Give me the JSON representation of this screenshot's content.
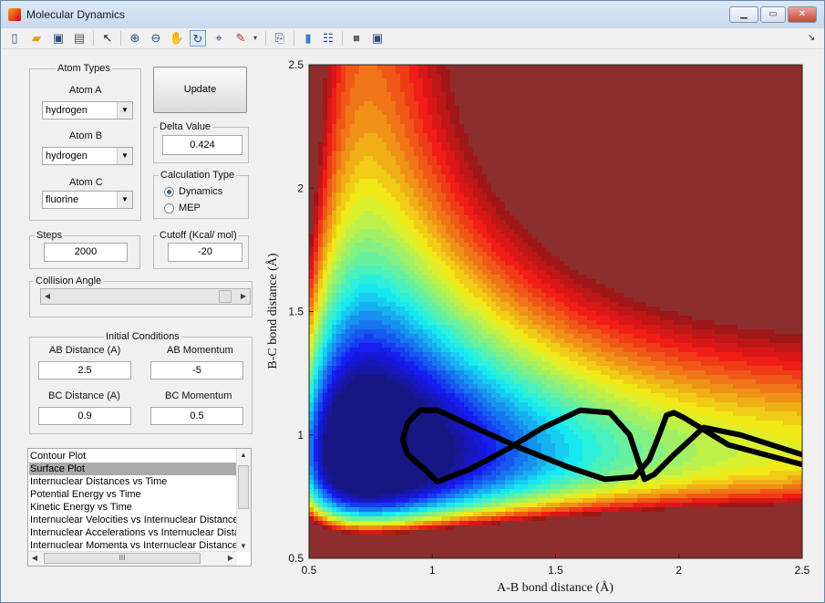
{
  "window": {
    "title": "Molecular Dynamics"
  },
  "toolbar": {
    "icons": [
      "new-file-icon",
      "open-folder-icon",
      "save-icon",
      "print-icon",
      "pointer-icon",
      "zoom-in-icon",
      "zoom-out-icon",
      "pan-hand-icon",
      "rotate-3d-icon",
      "data-cursor-icon",
      "brush-icon",
      "dropdown-arrow-icon",
      "link-plot-icon",
      "colorbar-icon",
      "legend-icon",
      "hide-plot-tools-icon",
      "show-plot-tools-icon",
      "dock-icon"
    ]
  },
  "controls": {
    "atom_types_title": "Atom Types",
    "atom_a_label": "Atom A",
    "atom_a_value": "hydrogen",
    "atom_b_label": "Atom B",
    "atom_b_value": "hydrogen",
    "atom_c_label": "Atom C",
    "atom_c_value": "fluorine",
    "update_label": "Update",
    "delta_title": "Delta Value",
    "delta_value": "0.424",
    "calc_type_title": "Calculation Type",
    "calc_options": [
      "Dynamics",
      "MEP"
    ],
    "calc_selected": "Dynamics",
    "steps_title": "Steps",
    "steps_value": "2000",
    "cutoff_title": "Cutoff (Kcal/ mol)",
    "cutoff_value": "-20",
    "collision_title": "Collision Angle",
    "collision_angle_fraction": 0.97,
    "initial_title": "Initial Conditions",
    "ab_distance_label": "AB Distance (A)",
    "ab_distance_value": "2.5",
    "ab_momentum_label": "AB Momentum",
    "ab_momentum_value": "-5",
    "bc_distance_label": "BC Distance (A)",
    "bc_distance_value": "0.9",
    "bc_momentum_label": "BC Momentum",
    "bc_momentum_value": "0.5"
  },
  "plot_list": {
    "items": [
      "Contour Plot",
      "Surface Plot",
      "Internuclear Distances vs Time",
      "Potential Energy vs Time",
      "Kinetic Energy vs Time",
      "Internuclear Velocities vs Internuclear Distance",
      "Internuclear Accelerations vs Internuclear Distance",
      "Internuclear Momenta vs Internuclear Distance"
    ],
    "selected": "Surface Plot",
    "hscroll_grip": "III"
  },
  "chart_data": {
    "type": "heatmap",
    "title": "",
    "xlabel": "A-B bond distance (Å)",
    "ylabel": "B-C bond distance (Å)",
    "xlim": [
      0.5,
      2.5
    ],
    "ylim": [
      0.5,
      2.5
    ],
    "xticks": [
      0.5,
      1,
      1.5,
      2,
      2.5
    ],
    "xtick_labels": [
      "0.5",
      "1",
      "1.5",
      "2",
      "2.5"
    ],
    "yticks": [
      0.5,
      1,
      1.5,
      2,
      2.5
    ],
    "ytick_labels": [
      "0.5",
      "1",
      "1.5",
      "2",
      "2.5"
    ],
    "colormap": "jet",
    "colors": {
      "high": "#8b0000",
      "low": "#00008f",
      "trajectory": "#000000"
    },
    "trajectory": {
      "x": [
        2.5,
        2.2,
        2.02,
        1.98,
        1.95,
        1.92,
        1.88,
        1.82,
        1.7,
        1.55,
        1.35,
        1.15,
        1.02,
        0.95,
        0.9,
        0.88,
        0.9,
        0.97,
        1.02,
        1.15,
        1.3,
        1.45,
        1.6,
        1.72,
        1.8,
        1.84,
        1.86,
        1.9,
        1.98,
        2.1,
        2.25,
        2.5
      ],
      "y": [
        0.88,
        0.96,
        1.07,
        1.09,
        1.08,
        1.0,
        0.9,
        0.83,
        0.82,
        0.87,
        0.95,
        1.04,
        1.1,
        1.1,
        1.05,
        0.98,
        0.92,
        0.86,
        0.81,
        0.86,
        0.94,
        1.03,
        1.1,
        1.09,
        1.0,
        0.88,
        0.82,
        0.84,
        0.92,
        1.03,
        1.0,
        0.92
      ]
    }
  }
}
